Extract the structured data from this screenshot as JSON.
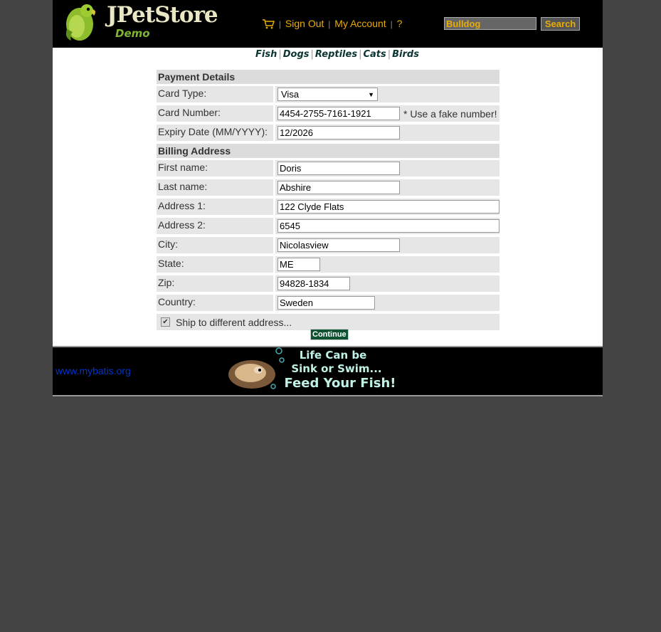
{
  "header": {
    "logo_title": "JPetStore",
    "logo_subtitle": "Demo",
    "menu": {
      "sign_out": "Sign Out",
      "my_account": "My Account",
      "help": "?"
    },
    "search": {
      "value": "Bulldog",
      "button": "Search"
    }
  },
  "quicklinks": [
    "Fish",
    "Dogs",
    "Reptiles",
    "Cats",
    "Birds"
  ],
  "payment": {
    "section_title": "Payment Details",
    "card_type": {
      "label": "Card Type:",
      "value": "Visa"
    },
    "card_number": {
      "label": "Card Number:",
      "value": "4454-2755-7161-1921",
      "note": "* Use a fake number!"
    },
    "expiry": {
      "label": "Expiry Date (MM/YYYY):",
      "value": "12/2026"
    }
  },
  "billing": {
    "section_title": "Billing Address",
    "first_name": {
      "label": "First name:",
      "value": "Doris"
    },
    "last_name": {
      "label": "Last name:",
      "value": "Abshire"
    },
    "address1": {
      "label": "Address 1:",
      "value": "122 Clyde Flats"
    },
    "address2": {
      "label": "Address 2:",
      "value": "6545"
    },
    "city": {
      "label": "City:",
      "value": "Nicolasview"
    },
    "state": {
      "label": "State:",
      "value": "ME"
    },
    "zip": {
      "label": "Zip:",
      "value": "94828-1834"
    },
    "country": {
      "label": "Country:",
      "value": "Sweden"
    }
  },
  "ship_different": {
    "label": "Ship to different address...",
    "checked": true
  },
  "continue_button": "Continue",
  "footer": {
    "link": "www.mybatis.org",
    "banner_lines": [
      "Life Can be",
      "Sink or Swim...",
      "Feed Your Fish!"
    ]
  },
  "colors": {
    "page_bg": "#444444",
    "header_bg": "#000000",
    "accent": "#eaac00",
    "continue_bg": "#0f5232"
  }
}
